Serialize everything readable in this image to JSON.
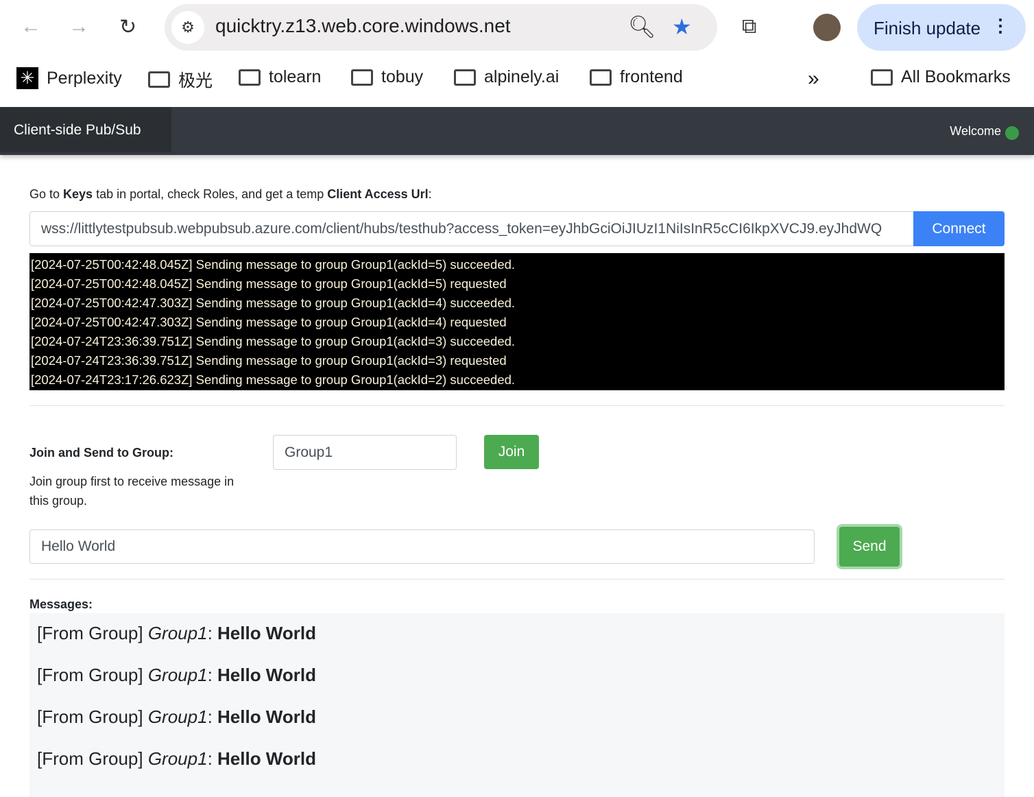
{
  "browser": {
    "url": "quicktry.z13.web.core.windows.net",
    "finish_update": "Finish update",
    "bookmarks": [
      "Perplexity",
      "极光",
      "tolearn",
      "tobuy",
      "alpinely.ai",
      "frontend"
    ],
    "all_bookmarks": "All Bookmarks"
  },
  "navbar": {
    "brand": "Client-side Pub/Sub",
    "welcome": "Welcome",
    "status_color": "#3a9a4a"
  },
  "intro": {
    "t1": "Go to ",
    "b1": "Keys",
    "t2": " tab in portal, check Roles, and get a temp ",
    "b2": "Client Access Url",
    "t3": ":"
  },
  "connect": {
    "url_value": "wss://littlytestpubsub.webpubsub.azure.com/client/hubs/testhub?access_token=eyJhbGciOiJIUzI1NiIsInR5cCI6IkpXVCJ9.eyJhdWQ",
    "button": "Connect",
    "color": "#3b82f6"
  },
  "log": [
    "[2024-07-25T00:42:48.045Z] Sending message to group Group1(ackId=5) succeeded.",
    "[2024-07-25T00:42:48.045Z] Sending message to group Group1(ackId=5) requested",
    "[2024-07-25T00:42:47.303Z] Sending message to group Group1(ackId=4) succeeded.",
    "[2024-07-25T00:42:47.303Z] Sending message to group Group1(ackId=4) requested",
    "[2024-07-24T23:36:39.751Z] Sending message to group Group1(ackId=3) succeeded.",
    "[2024-07-24T23:36:39.751Z] Sending message to group Group1(ackId=3) requested",
    "[2024-07-24T23:17:26.623Z] Sending message to group Group1(ackId=2) succeeded."
  ],
  "group": {
    "label": "Join and Send to Group:",
    "hint": "Join group first to receive message in this group.",
    "value": "Group1",
    "join": "Join",
    "message_value": "Hello World",
    "send": "Send"
  },
  "messages": {
    "label": "Messages:",
    "items": [
      {
        "prefix": "[From Group] ",
        "group": "Group1",
        "sep": ": ",
        "text": "Hello World"
      },
      {
        "prefix": "[From Group] ",
        "group": "Group1",
        "sep": ": ",
        "text": "Hello World"
      },
      {
        "prefix": "[From Group] ",
        "group": "Group1",
        "sep": ": ",
        "text": "Hello World"
      },
      {
        "prefix": "[From Group] ",
        "group": "Group1",
        "sep": ": ",
        "text": "Hello World"
      }
    ]
  }
}
